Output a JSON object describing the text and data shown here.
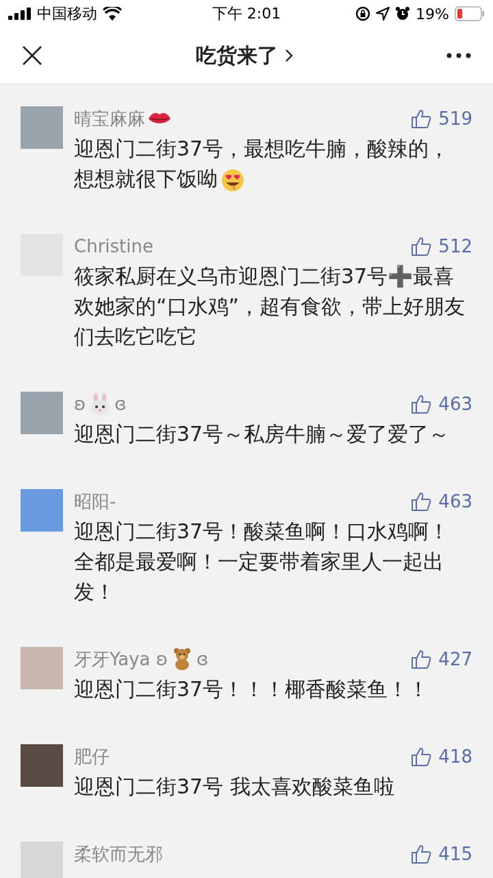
{
  "status_bar": {
    "carrier": "中国移动",
    "time": "下午 2:01",
    "battery": "19%"
  },
  "nav": {
    "title": "吃货来了"
  },
  "comments": [
    {
      "name": [
        {
          "kind": "text",
          "text": "晴宝麻麻"
        },
        {
          "kind": "lips"
        }
      ],
      "likes": "519",
      "body": [
        {
          "kind": "text",
          "text": "迎恩门二街37号，最想吃牛腩，酸辣的，想想就很下饭呦"
        },
        {
          "kind": "starface"
        }
      ]
    },
    {
      "name": [
        {
          "kind": "text",
          "text": "Christine"
        }
      ],
      "likes": "512",
      "body": [
        {
          "kind": "text",
          "text": "筱家私厨在义乌市迎恩门二街37号➕最喜欢她家的“口水鸡”，超有食欲，带上好朋友们去吃它吃它"
        }
      ]
    },
    {
      "name": [
        {
          "kind": "text",
          "text": "ʚ"
        },
        {
          "kind": "rabbit"
        },
        {
          "kind": "text",
          "text": "ɞ"
        }
      ],
      "likes": "463",
      "body": [
        {
          "kind": "text",
          "text": "迎恩门二街37号～私房牛腩～爱了爱了～"
        }
      ]
    },
    {
      "name": [
        {
          "kind": "text",
          "text": "昭阳-"
        }
      ],
      "likes": "463",
      "body": [
        {
          "kind": "text",
          "text": "迎恩门二街37号！酸菜鱼啊！口水鸡啊！全都是最爱啊！一定要带着家里人一起出发！"
        }
      ]
    },
    {
      "name": [
        {
          "kind": "text",
          "text": "牙牙Yaya ʚ"
        },
        {
          "kind": "bear"
        },
        {
          "kind": "text",
          "text": "ɞ"
        }
      ],
      "likes": "427",
      "body": [
        {
          "kind": "text",
          "text": "迎恩门二街37号！！！椰香酸菜鱼！！"
        }
      ]
    },
    {
      "name": [
        {
          "kind": "text",
          "text": "肥仔"
        }
      ],
      "likes": "418",
      "body": [
        {
          "kind": "text",
          "text": "迎恩门二街37号 我太喜欢酸菜鱼啦"
        }
      ]
    },
    {
      "name": [
        {
          "kind": "text",
          "text": "柔软而无邪"
        }
      ],
      "likes": "415"
    }
  ]
}
